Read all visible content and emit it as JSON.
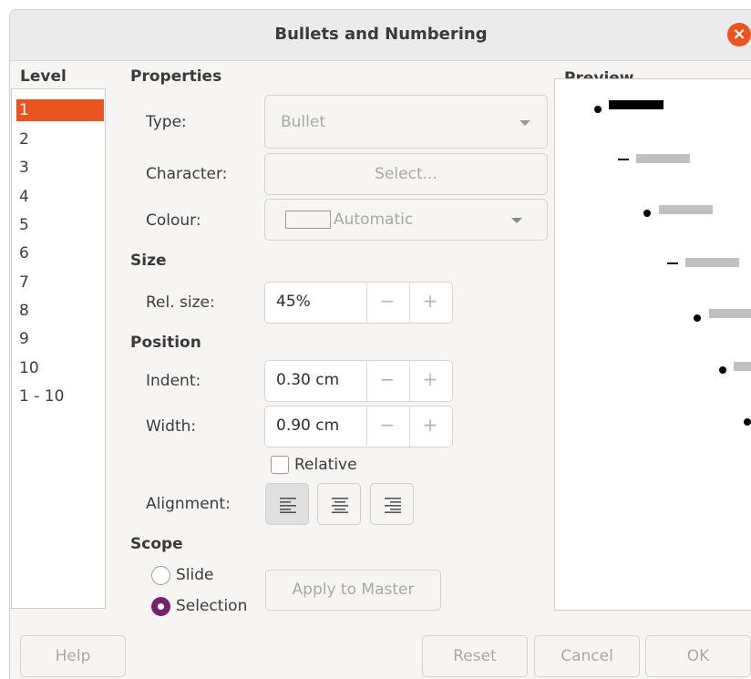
{
  "dialog": {
    "title": "Bullets and Numbering"
  },
  "level": {
    "heading": "Level",
    "items": [
      "1",
      "2",
      "3",
      "4",
      "5",
      "6",
      "7",
      "8",
      "9",
      "10",
      "1 - 10"
    ],
    "selected": "1"
  },
  "properties": {
    "heading": "Properties",
    "type_label": "Type:",
    "type_value": "Bullet",
    "character_label": "Character:",
    "character_button": "Select...",
    "colour_label": "Colour:",
    "colour_value": "Automatic"
  },
  "size": {
    "heading": "Size",
    "rel_size_label": "Rel. size:",
    "rel_size_value": "45%"
  },
  "position": {
    "heading": "Position",
    "indent_label": "Indent:",
    "indent_value": "0.30 cm",
    "width_label": "Width:",
    "width_value": "0.90 cm",
    "relative_label": "Relative",
    "relative_checked": false,
    "alignment_label": "Alignment:",
    "alignment_selected": "left"
  },
  "scope": {
    "heading": "Scope",
    "slide_label": "Slide",
    "selection_label": "Selection",
    "selected": "Selection",
    "apply_button": "Apply to Master"
  },
  "preview": {
    "heading": "Preview"
  },
  "footer": {
    "help": "Help",
    "reset": "Reset",
    "cancel": "Cancel",
    "ok": "OK"
  },
  "colors": {
    "accent": "#e95420",
    "radio_selected": "#77216f",
    "disabled_text": "#a8a8a8"
  },
  "icons": {
    "close": "close-icon",
    "dropdown": "chevron-down-icon",
    "align_left": "align-left-icon",
    "align_center": "align-center-icon",
    "align_right": "align-right-icon"
  }
}
